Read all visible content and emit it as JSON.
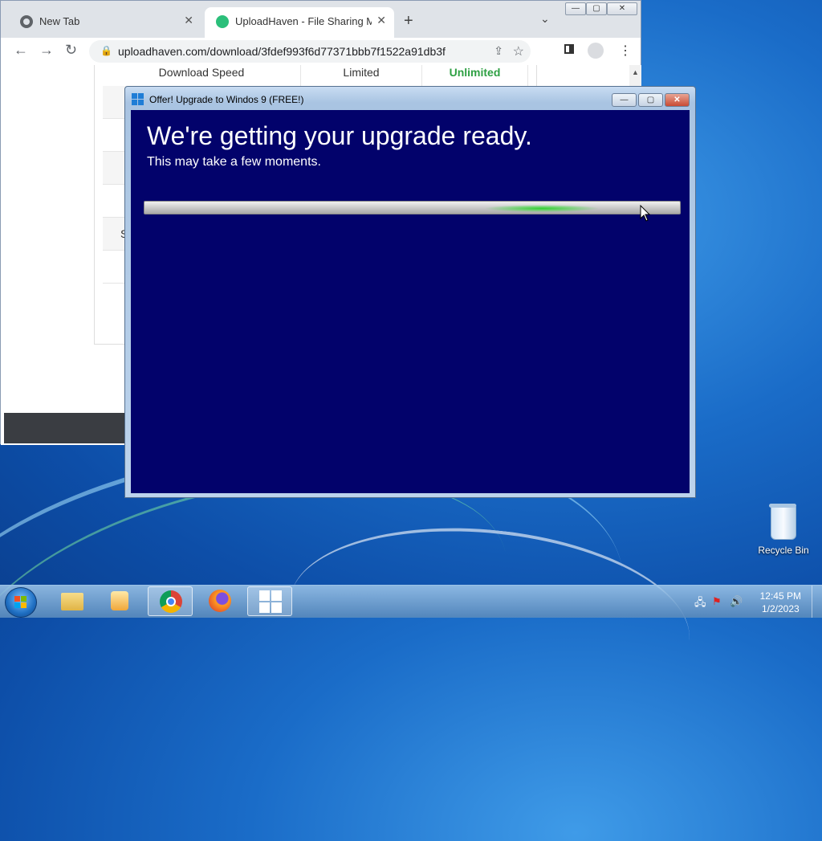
{
  "browser": {
    "tabs": [
      {
        "label": "New Tab",
        "close": "✕"
      },
      {
        "label": "UploadHaven - File Sharing Mad",
        "close": "✕"
      }
    ],
    "new_tab": "+",
    "tab_dropdown": "⌄",
    "window_controls": {
      "minimize": "—",
      "maximize": "▢",
      "close": "✕"
    },
    "nav": {
      "back": "←",
      "forward": "→",
      "reload": "↻"
    },
    "url": "uploadhaven.com/download/3fdef993f6d77371bbb7f1522a91db3f",
    "page": {
      "table": {
        "rows": [
          {
            "label": "Download Speed",
            "free": "Limited",
            "premium": "Unlimited"
          }
        ],
        "partial_label": "S"
      }
    }
  },
  "popup": {
    "title": "Offer! Upgrade to Windos 9 (FREE!)",
    "buttons": {
      "minimize": "—",
      "maximize": "▢",
      "close": "✕"
    },
    "heading": "We're getting your upgrade ready.",
    "subheading": "This may take a few moments."
  },
  "desktop": {
    "icons": [
      {
        "label": "Recycle Bin",
        "icon": "recycle-bin-icon"
      }
    ]
  },
  "taskbar": {
    "apps": [
      {
        "name": "file-explorer",
        "icon": "folder-icon"
      },
      {
        "name": "media-player",
        "icon": "media-player-icon"
      },
      {
        "name": "chrome",
        "icon": "chrome-icon"
      },
      {
        "name": "firefox",
        "icon": "firefox-icon"
      },
      {
        "name": "windows-upgrade",
        "icon": "windows-logo-icon"
      }
    ],
    "clock": {
      "time": "12:45 PM",
      "date": "1/2/2023"
    }
  },
  "colors": {
    "popup_background": "#02026b",
    "unlimited_green": "#2ea043"
  }
}
